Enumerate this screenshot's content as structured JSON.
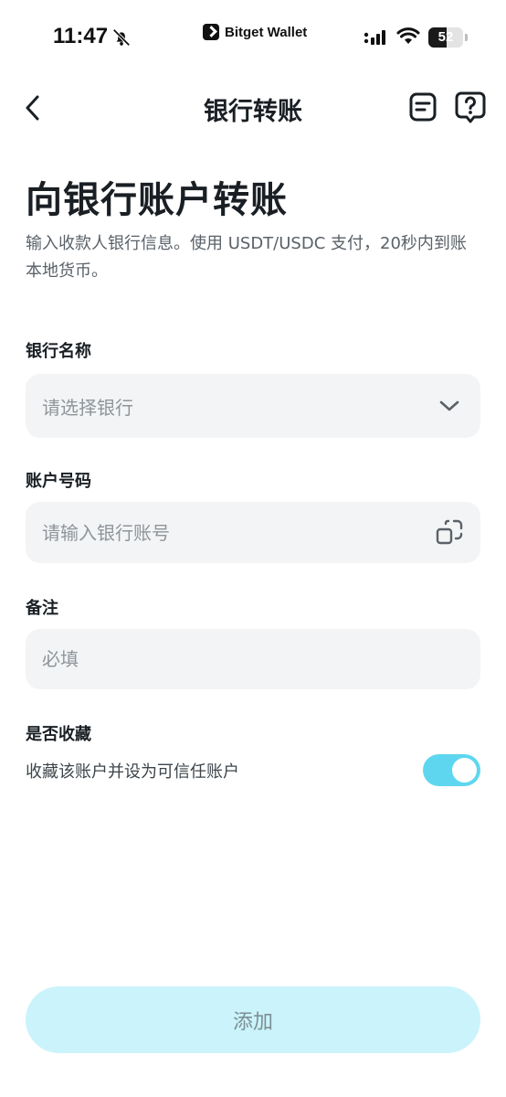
{
  "status_bar": {
    "time": "11:47",
    "app_name": "Bitget Wallet",
    "battery_level": "52",
    "battery_fraction": 0.52
  },
  "nav": {
    "title": "银行转账"
  },
  "header": {
    "title": "向银行账户转账",
    "description": "输入收款人银行信息。使用 USDT/USDC 支付，20秒内到账本地货币。"
  },
  "form": {
    "bank_name": {
      "label": "银行名称",
      "placeholder": "请选择银行"
    },
    "account_number": {
      "label": "账户号码",
      "placeholder": "请输入银行账号"
    },
    "note": {
      "label": "备注",
      "placeholder": "必填"
    },
    "favorite": {
      "label": "是否收藏",
      "description": "收藏该账户并设为可信任账户",
      "enabled": true
    }
  },
  "actions": {
    "add_label": "添加"
  },
  "colors": {
    "accent": "#5fd6ef",
    "button_bg": "#cbf3fb",
    "field_bg": "#f3f4f5"
  }
}
